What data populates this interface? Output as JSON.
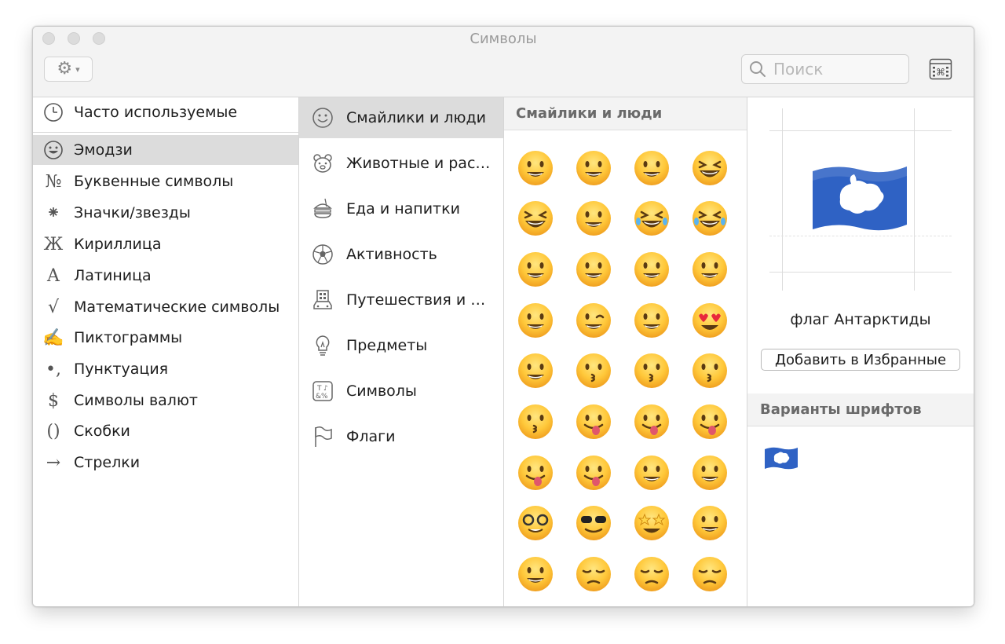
{
  "window": {
    "title": "Символы"
  },
  "toolbar": {
    "gear_icon": "gear-icon",
    "search": {
      "placeholder": "Поиск",
      "value": ""
    },
    "keyboard_viewer_icon": "keyboard-viewer-icon"
  },
  "categories": [
    {
      "label": "Часто используемые",
      "icon": "clock-icon",
      "glyph": ""
    },
    {
      "label": "Эмодзи",
      "icon": "smiley-icon",
      "glyph": "",
      "selected": true
    },
    {
      "label": "Буквенные символы",
      "icon": "numero-icon",
      "glyph": "№"
    },
    {
      "label": "Значки/звезды",
      "icon": "asterisk-icon",
      "glyph": "⁕"
    },
    {
      "label": "Кириллица",
      "icon": "cyrillic-icon",
      "glyph": "Ж"
    },
    {
      "label": "Латиница",
      "icon": "latin-icon",
      "glyph": "A"
    },
    {
      "label": "Математические символы",
      "icon": "sqrt-icon",
      "glyph": "√"
    },
    {
      "label": "Пиктограммы",
      "icon": "pictogram-icon",
      "glyph": "✍"
    },
    {
      "label": "Пунктуация",
      "icon": "punctuation-icon",
      "glyph": "•,"
    },
    {
      "label": "Символы валют",
      "icon": "dollar-icon",
      "glyph": "$"
    },
    {
      "label": "Скобки",
      "icon": "brackets-icon",
      "glyph": "()"
    },
    {
      "label": "Стрелки",
      "icon": "arrow-icon",
      "glyph": "→"
    }
  ],
  "subcategories": [
    {
      "label": "Смайлики и люди",
      "icon": "smiley-outline-icon",
      "selected": true
    },
    {
      "label": "Животные и раст…",
      "icon": "bear-outline-icon"
    },
    {
      "label": "Еда и напитки",
      "icon": "burger-outline-icon"
    },
    {
      "label": "Активность",
      "icon": "soccer-ball-outline-icon"
    },
    {
      "label": "Путешествия и м…",
      "icon": "building-car-outline-icon"
    },
    {
      "label": "Предметы",
      "icon": "lightbulb-outline-icon"
    },
    {
      "label": "Символы",
      "icon": "symbols-outline-icon"
    },
    {
      "label": "Флаги",
      "icon": "flag-outline-icon"
    }
  ],
  "grid": {
    "header": "Смайлики и люди",
    "emojis": [
      "grinning-face",
      "grinning-face-big-eyes",
      "grinning-face-smiling-eyes",
      "beaming-face",
      "grinning-squinting-face",
      "grinning-face-sweat",
      "tears-of-joy",
      "rolling-on-floor-laughing",
      "smiling-face",
      "smiling-face-smiling-eyes",
      "smiling-face-halo",
      "slightly-smiling-face",
      "upside-down-face",
      "winking-face",
      "relieved-face",
      "heart-eyes",
      "smiling-face-hearts",
      "face-blowing-kiss",
      "kissing-face",
      "kissing-face-smiling-eyes",
      "kissing-face-closed-eyes",
      "face-savoring-food",
      "face-tongue",
      "squinting-face-tongue",
      "winking-face-tongue",
      "zany-face",
      "raised-eyebrow-face",
      "monocle-face",
      "nerd-face",
      "sunglasses-face",
      "star-struck",
      "partying-face",
      "smirking-face",
      "unamused-face",
      "disappointed-face",
      "pensive-face"
    ]
  },
  "detail": {
    "char_name": "флаг Антарктиды",
    "favorites_button": "Добавить в Избранные",
    "variants_header": "Варианты шрифтов",
    "flag_color": "#2f62c4"
  },
  "colors": {
    "selection": "#dcdcdc",
    "emoji_yellow": "#ffc83a"
  }
}
